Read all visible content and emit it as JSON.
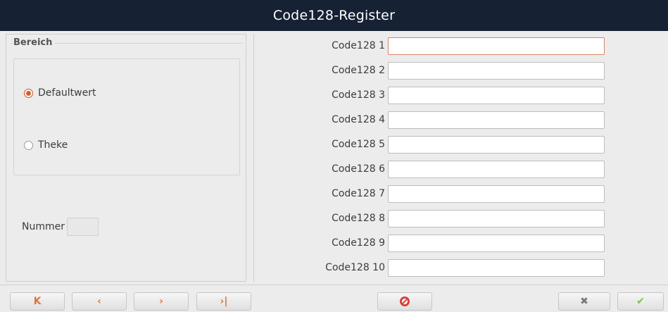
{
  "window": {
    "title": "Code128-Register"
  },
  "left": {
    "group_title": "Bereich",
    "radio_options": [
      {
        "label": "Defaultwert",
        "checked": true
      },
      {
        "label": "Theke",
        "checked": false
      }
    ],
    "nummer_label": "Nummer",
    "nummer_value": ""
  },
  "form": {
    "rows": [
      {
        "label": "Code128 1",
        "value": ""
      },
      {
        "label": "Code128 2",
        "value": ""
      },
      {
        "label": "Code128 3",
        "value": ""
      },
      {
        "label": "Code128 4",
        "value": ""
      },
      {
        "label": "Code128 5",
        "value": ""
      },
      {
        "label": "Code128 6",
        "value": ""
      },
      {
        "label": "Code128 7",
        "value": ""
      },
      {
        "label": "Code128 8",
        "value": ""
      },
      {
        "label": "Code128 9",
        "value": ""
      },
      {
        "label": "Code128 10",
        "value": ""
      }
    ]
  },
  "toolbar": {
    "icons": {
      "first": "first-record-icon",
      "prev": "previous-record-icon",
      "next": "next-record-icon",
      "last": "last-record-icon",
      "delete": "no-entry-icon",
      "cancel": "close-icon",
      "ok": "checkmark-icon"
    },
    "colors": {
      "nav": "#e0733d",
      "delete": "#d6423a",
      "ok": "#7fc43d"
    }
  }
}
